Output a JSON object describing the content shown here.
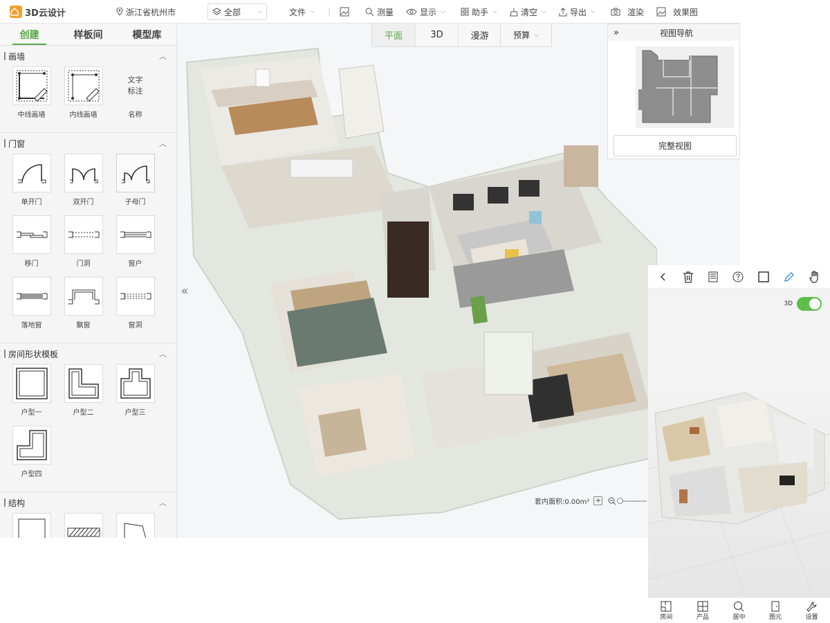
{
  "app": {
    "name": "3D云设计",
    "location": "浙江省杭州市",
    "scope": "全部"
  },
  "toolbar": {
    "file": "文件",
    "measure": "测量",
    "display": "显示",
    "assistant": "助手",
    "clear": "清空",
    "export": "导出",
    "render": "渲染",
    "effect": "效果图"
  },
  "sidebar": {
    "tabs": [
      "创建",
      "样板间",
      "模型库"
    ],
    "sections": {
      "wall": {
        "title": "画墙",
        "items": [
          "中线画墙",
          "内线画墙"
        ],
        "text_tool": {
          "line1": "文字",
          "line2": "标注",
          "label": "名称"
        }
      },
      "doors": {
        "title": "门窗",
        "items": [
          "单开门",
          "双开门",
          "子母门",
          "移门",
          "门洞",
          "窗户",
          "落地窗",
          "飘窗",
          "窗洞"
        ]
      },
      "rooms": {
        "title": "房间形状模板",
        "items": [
          "户型一",
          "户型二",
          "户型三",
          "户型四"
        ]
      },
      "structure": {
        "title": "结构"
      }
    }
  },
  "view_tabs": [
    "平面",
    "3D",
    "漫游"
  ],
  "budget": "预算",
  "navigator": {
    "title": "视图导航",
    "full_view": "完整视图"
  },
  "status": {
    "area": "套内面积:0.00m²"
  },
  "mobile": {
    "toggle_label": "3D",
    "bottom": [
      "房间",
      "产品",
      "居中",
      "图元",
      "设置"
    ]
  },
  "colors": {
    "accent": "#58a844",
    "logo": "#f0a030",
    "toggle": "#5cbf4a"
  }
}
